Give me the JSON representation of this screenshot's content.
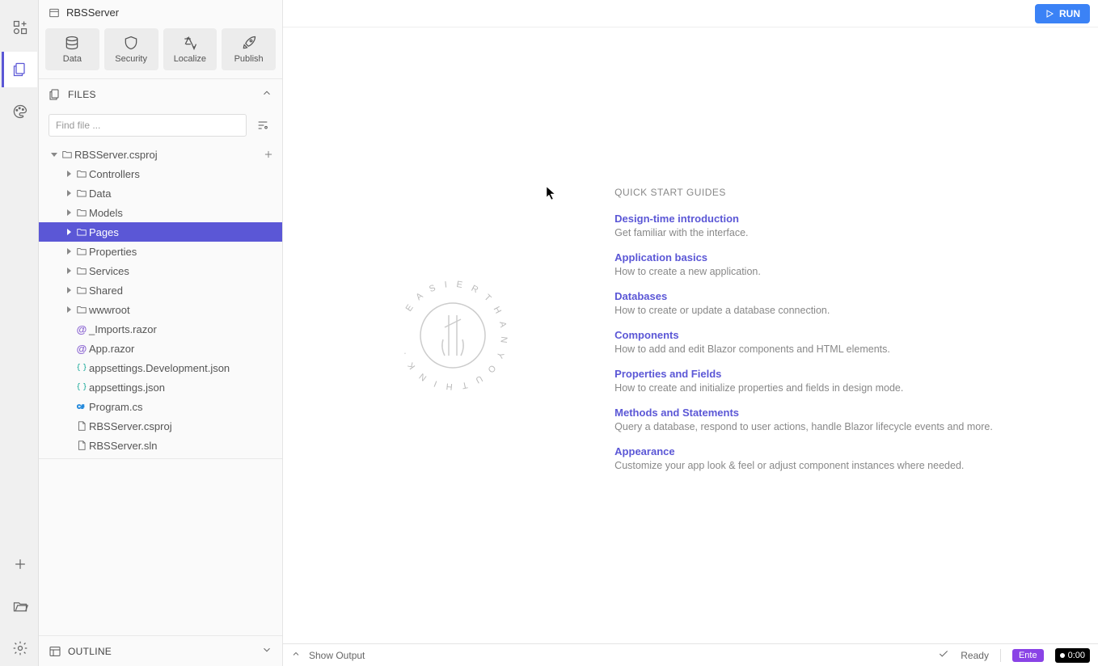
{
  "project_name": "RBSServer",
  "toolbar": {
    "data": "Data",
    "security": "Security",
    "localize": "Localize",
    "publish": "Publish"
  },
  "panels": {
    "files": "FILES",
    "outline": "OUTLINE"
  },
  "search": {
    "placeholder": "Find file ..."
  },
  "tree": {
    "root": "RBSServer.csproj",
    "folders": {
      "controllers": "Controllers",
      "data": "Data",
      "models": "Models",
      "pages": "Pages",
      "properties": "Properties",
      "services": "Services",
      "shared": "Shared",
      "wwwroot": "wwwroot"
    },
    "files": {
      "imports": "_Imports.razor",
      "app": "App.razor",
      "appsettings_dev": "appsettings.Development.json",
      "appsettings": "appsettings.json",
      "program": "Program.cs",
      "csproj": "RBSServer.csproj",
      "sln": "RBSServer.sln"
    }
  },
  "run_label": "RUN",
  "guides": {
    "heading": "QUICK START GUIDES",
    "items": [
      {
        "title": "Design-time introduction",
        "desc": "Get familiar with the interface."
      },
      {
        "title": "Application basics",
        "desc": "How to create a new application."
      },
      {
        "title": "Databases",
        "desc": "How to create or update a database connection."
      },
      {
        "title": "Components",
        "desc": "How to add and edit Blazor components and HTML elements."
      },
      {
        "title": "Properties and Fields",
        "desc": "How to create and initialize properties and fields in design mode."
      },
      {
        "title": "Methods and Statements",
        "desc": "Query a database, respond to user actions, handle Blazor lifecycle events and more."
      },
      {
        "title": "Appearance",
        "desc": "Customize your app look & feel or adjust component instances where needed."
      }
    ]
  },
  "statusbar": {
    "show_output": "Show Output",
    "ready": "Ready",
    "enter": "Ente",
    "timer": "0:00"
  },
  "logo_text": "EASIER THAN YOU THINK"
}
